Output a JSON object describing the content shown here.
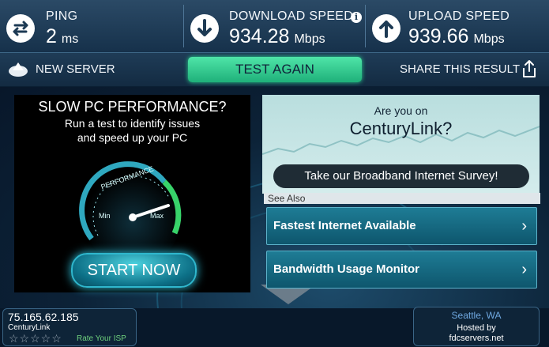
{
  "stats": {
    "ping": {
      "label": "PING",
      "value": "2",
      "unit": "ms"
    },
    "download": {
      "label": "DOWNLOAD SPEED",
      "value": "934.28",
      "unit": "Mbps"
    },
    "upload": {
      "label": "UPLOAD SPEED",
      "value": "939.66",
      "unit": "Mbps"
    },
    "info_glyph": "i"
  },
  "actions": {
    "new_server": "NEW SERVER",
    "test_again": "TEST AGAIN",
    "share": "SHARE THIS RESULT"
  },
  "ad_left": {
    "title": "SLOW PC PERFORMANCE?",
    "sub1": "Run a test to identify issues",
    "sub2": "and speed up your PC",
    "gauge_label": "PERFORMANCE",
    "gauge_min": "Min",
    "gauge_max": "Max",
    "cta": "START NOW"
  },
  "ad_right": {
    "line1": "Are you on",
    "line2": "CenturyLink?",
    "button": "Take our Broadband Internet Survey!"
  },
  "see_also": {
    "label": "See Also",
    "links": [
      {
        "text": "Fastest Internet Available"
      },
      {
        "text": "Bandwidth Usage Monitor"
      }
    ]
  },
  "isp": {
    "ip": "75.165.62.185",
    "name": "CenturyLink",
    "stars": "☆☆☆☆☆",
    "rate": "Rate Your ISP"
  },
  "server": {
    "city": "Seattle, WA",
    "hosted_by": "Hosted by",
    "host": "fdcservers.net"
  },
  "colors": {
    "accent_green": "#27d591",
    "header_bg": "#1d3a54",
    "link_bg": "#1e7c95"
  }
}
